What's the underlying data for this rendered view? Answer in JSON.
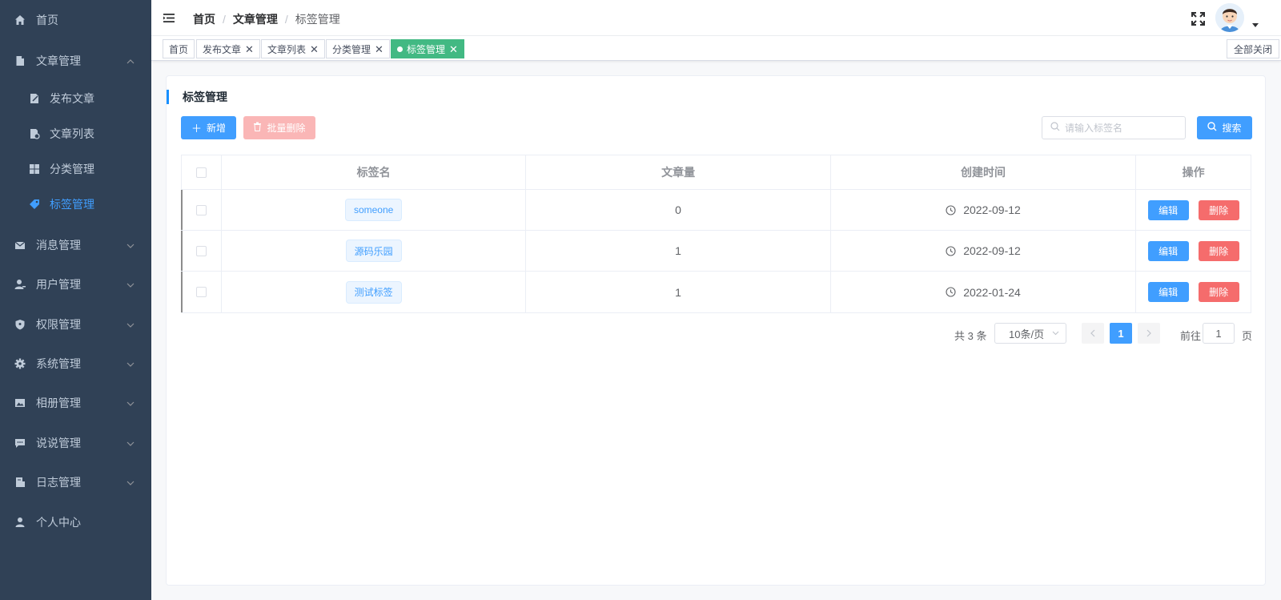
{
  "sidebar": {
    "items": [
      {
        "label": "首页",
        "icon": "home-icon"
      },
      {
        "label": "文章管理",
        "icon": "document-icon",
        "expanded": true
      },
      {
        "label": "消息管理",
        "icon": "mail-icon"
      },
      {
        "label": "用户管理",
        "icon": "user-icon"
      },
      {
        "label": "权限管理",
        "icon": "shield-icon"
      },
      {
        "label": "系统管理",
        "icon": "gear-icon"
      },
      {
        "label": "相册管理",
        "icon": "picture-icon"
      },
      {
        "label": "说说管理",
        "icon": "chat-icon"
      },
      {
        "label": "日志管理",
        "icon": "log-icon"
      },
      {
        "label": "个人中心",
        "icon": "person-icon"
      }
    ],
    "sub_items": [
      {
        "label": "发布文章",
        "icon": "edit-icon"
      },
      {
        "label": "文章列表",
        "icon": "list-icon"
      },
      {
        "label": "分类管理",
        "icon": "grid-icon"
      },
      {
        "label": "标签管理",
        "icon": "tag-icon",
        "active": true
      }
    ]
  },
  "header": {
    "breadcrumb": [
      "首页",
      "文章管理",
      "标签管理"
    ]
  },
  "tags": {
    "items": [
      {
        "label": "首页",
        "closable": false
      },
      {
        "label": "发布文章",
        "closable": true
      },
      {
        "label": "文章列表",
        "closable": true
      },
      {
        "label": "分类管理",
        "closable": true
      },
      {
        "label": "标签管理",
        "closable": true,
        "active": true
      }
    ],
    "close_all": "全部关闭"
  },
  "main": {
    "title": "标签管理",
    "add_label": "新增",
    "batch_delete_label": "批量删除",
    "search_placeholder": "请输入标签名",
    "search_label": "搜索",
    "table": {
      "columns": [
        "标签名",
        "文章量",
        "创建时间",
        "操作"
      ],
      "rows": [
        {
          "name": "someone",
          "count": "0",
          "created": "2022-09-12"
        },
        {
          "name": "源码乐园",
          "count": "1",
          "created": "2022-09-12"
        },
        {
          "name": "测试标签",
          "count": "1",
          "created": "2022-01-24"
        }
      ],
      "edit_label": "编辑",
      "delete_label": "删除"
    },
    "pagination": {
      "total": "共 3 条",
      "page_size": "10条/页",
      "current_page": "1",
      "goto_label": "前往",
      "goto_value": "1",
      "page_suffix": "页"
    }
  },
  "colors": {
    "sidebar_bg": "#304156",
    "primary": "#409eff",
    "danger": "#f56c6c",
    "active_tag": "#42b983"
  }
}
